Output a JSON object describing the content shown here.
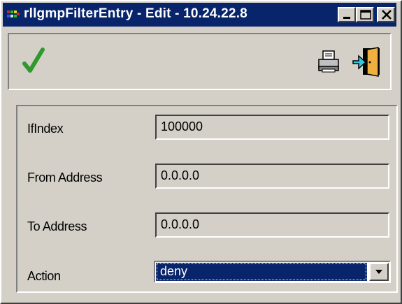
{
  "window": {
    "title": "rllgmpFilterEntry -  Edit - 10.24.22.8"
  },
  "toolbar": {
    "apply_icon": "check-icon",
    "print_icon": "printer-icon",
    "exit_icon": "exit-door-icon"
  },
  "form": {
    "fields": [
      {
        "label": "IfIndex",
        "value": "100000"
      },
      {
        "label": "From Address",
        "value": "0.0.0.0"
      },
      {
        "label": "To Address",
        "value": "0.0.0.0"
      }
    ],
    "action": {
      "label": "Action",
      "selected": "deny"
    }
  },
  "colors": {
    "title_bar": "#08246b",
    "face": "#d4d0c8",
    "check": "#2e9a2e",
    "selection": "#08246b"
  }
}
